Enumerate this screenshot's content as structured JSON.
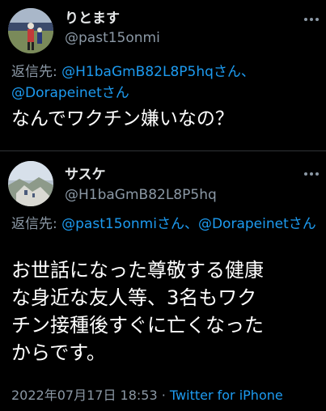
{
  "tweet1": {
    "display_name": "りとます",
    "handle": "@past15onmi",
    "reply_prefix": "返信先: ",
    "reply_mentions": [
      "@H1baGmB82L8P5hqさん、",
      "@Dorapeinetさん"
    ],
    "text": "なんでワクチン嫌いなの？"
  },
  "tweet2": {
    "display_name": "サスケ",
    "handle": "@H1baGmB82L8P5hq",
    "reply_prefix": "返信先: ",
    "reply_mentions": [
      "@past15onmiさん、",
      "@Dorapeinetさん"
    ],
    "text_lines": [
      "お世話になった尊敬する健康",
      "な身近な友人等、3名もワク",
      "チン接種後すぐに亡くなった",
      "からです。"
    ],
    "timestamp": "2022年07月17日 18:53",
    "separator": " · ",
    "source": "Twitter for iPhone"
  },
  "colors": {
    "background": "#000000",
    "text": "#ffffff",
    "secondary": "#8b98a5",
    "link": "#1d9bf0",
    "divider": "#2f3336"
  },
  "icons": [
    "more-options-icon"
  ]
}
